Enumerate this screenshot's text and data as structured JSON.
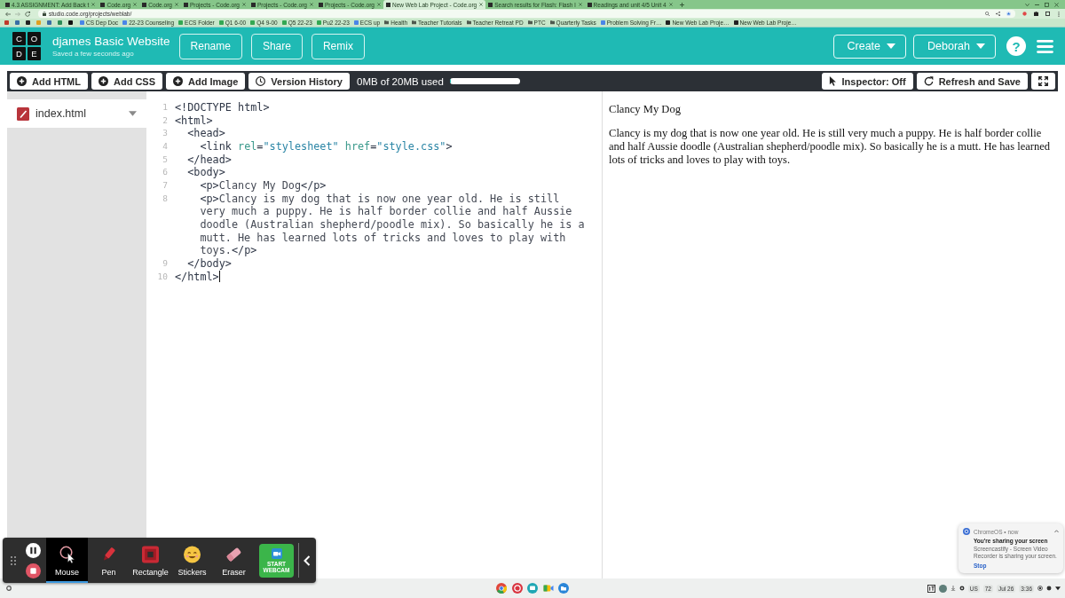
{
  "browser": {
    "tabs": [
      {
        "title": "4.3 ASSIGNMENT: Add Back t",
        "selected": false
      },
      {
        "title": "Code.org",
        "selected": false
      },
      {
        "title": "Code.org",
        "selected": false
      },
      {
        "title": "Projects - Code.org",
        "selected": false
      },
      {
        "title": "Projects - Code.org",
        "selected": false
      },
      {
        "title": "Projects - Code.org",
        "selected": false
      },
      {
        "title": "New Web Lab Project - Code.org",
        "selected": true
      },
      {
        "title": "Search results for Flash: Flash l",
        "selected": false
      },
      {
        "title": "Readings and unit 4/5 Unit 4",
        "selected": false
      }
    ],
    "url": "studio.code.org/projects/weblab/",
    "bookmarks": [
      {
        "kind": "doc",
        "label": "CS Dep Doc"
      },
      {
        "kind": "doc",
        "label": "22-23 Counseling"
      },
      {
        "kind": "sheet",
        "label": "ECS Folder"
      },
      {
        "kind": "sheet",
        "label": "Q1 6-00"
      },
      {
        "kind": "sheet",
        "label": "Q4 9-00"
      },
      {
        "kind": "sheet",
        "label": "Q5 22-23"
      },
      {
        "kind": "sheet",
        "label": "Pu2 22-23"
      },
      {
        "kind": "doc",
        "label": "ECS up"
      },
      {
        "kind": "folder",
        "label": "Health"
      },
      {
        "kind": "folder",
        "label": "Teacher Tutorials"
      },
      {
        "kind": "folder",
        "label": "Teacher Retreat PD"
      },
      {
        "kind": "folder",
        "label": "PTC"
      },
      {
        "kind": "folder",
        "label": "Quarterly Tasks"
      },
      {
        "kind": "doc",
        "label": "Problem Solving Fr…"
      },
      {
        "kind": "page",
        "label": "New Web Lab Proje…"
      },
      {
        "kind": "page",
        "label": "New Web Lab Proje…"
      }
    ]
  },
  "header": {
    "logo_letters": [
      "C",
      "O",
      "D",
      "E"
    ],
    "title": "djames Basic Website",
    "subtitle": "Saved a few seconds ago",
    "buttons": [
      "Rename",
      "Share",
      "Remix"
    ],
    "menus": [
      "Create",
      "Deborah"
    ],
    "help": "?"
  },
  "toolbar": {
    "buttons": [
      {
        "kind": "add",
        "label": "Add HTML"
      },
      {
        "kind": "add",
        "label": "Add CSS"
      },
      {
        "kind": "add",
        "label": "Add Image"
      },
      {
        "kind": "history",
        "label": "Version History"
      }
    ],
    "storage": {
      "label": "0MB of 20MB used",
      "level": 0
    },
    "right_buttons": [
      {
        "kind": "inspector",
        "label": "Inspector: Off"
      },
      {
        "kind": "refresh",
        "label": "Refresh and Save"
      },
      {
        "kind": "fullscreen"
      }
    ]
  },
  "files": [
    {
      "name": "index.html",
      "selected": true
    }
  ],
  "editor": {
    "lines": [
      {
        "number": "1",
        "caret": false,
        "segments": [
          {
            "kind": "tag",
            "text": "<!DOCTYPE html>"
          }
        ]
      },
      {
        "number": "2",
        "caret": false,
        "segments": [
          {
            "kind": "tag",
            "text": "<html>"
          }
        ]
      },
      {
        "number": "3",
        "caret": false,
        "segments": [
          {
            "kind": "tag",
            "text": "  <head>"
          }
        ]
      },
      {
        "number": "4",
        "caret": false,
        "segments": [
          {
            "kind": "tag",
            "text": "    <link "
          },
          {
            "kind": "attr",
            "text": "rel"
          },
          {
            "kind": "tag",
            "text": "="
          },
          {
            "kind": "string",
            "text": "\"stylesheet\""
          },
          {
            "kind": "attr",
            "text": " href"
          },
          {
            "kind": "tag",
            "text": "="
          },
          {
            "kind": "string",
            "text": "\"style.css\""
          },
          {
            "kind": "tag",
            "text": ">"
          }
        ]
      },
      {
        "number": "5",
        "caret": false,
        "segments": [
          {
            "kind": "tag",
            "text": "  </head>"
          }
        ]
      },
      {
        "number": "6",
        "caret": false,
        "segments": [
          {
            "kind": "tag",
            "text": "  <body>"
          }
        ]
      },
      {
        "number": "7",
        "caret": false,
        "segments": [
          {
            "kind": "tag",
            "text": "    <p>"
          },
          {
            "kind": "text",
            "text": "Clancy My Dog"
          },
          {
            "kind": "tag",
            "text": "</p>"
          }
        ]
      },
      {
        "number": "8",
        "caret": false,
        "segments": [
          {
            "kind": "tag",
            "text": "    <p>"
          },
          {
            "kind": "text",
            "text": "Clancy is my dog that is now one year old. He is still very much a puppy. He is half border collie and half Aussie doodle (Australian shepherd/poodle mix). So basically he is a mutt. He has learned lots of tricks and loves to play with toys."
          },
          {
            "kind": "tag",
            "text": "</p>"
          }
        ]
      },
      {
        "number": "9",
        "caret": false,
        "segments": [
          {
            "kind": "tag",
            "text": "  </body>"
          }
        ]
      },
      {
        "number": "10",
        "caret": true,
        "segments": [
          {
            "kind": "tag",
            "text": "</html>"
          }
        ]
      }
    ]
  },
  "preview": {
    "paragraphs": [
      "Clancy My Dog",
      "Clancy is my dog that is now one year old. He is still very much a puppy. He is half border collie and half Aussie doodle (Australian shepherd/poodle mix). So basically he is a mutt. He has learned lots of tricks and loves to play with toys."
    ]
  },
  "recorder": {
    "tools": [
      {
        "kind": "mouse",
        "label": "Mouse",
        "selected": true
      },
      {
        "kind": "pen",
        "label": "Pen",
        "selected": false
      },
      {
        "kind": "rectangle",
        "label": "Rectangle",
        "selected": false
      },
      {
        "kind": "stickers",
        "label": "Stickers",
        "selected": false
      },
      {
        "kind": "eraser",
        "label": "Eraser",
        "selected": false
      }
    ],
    "webcam_button": "START WEBCAM"
  },
  "notification": {
    "source": "ChromeOS • now",
    "title": "You're sharing your screen",
    "body": "Screencastify - Screen Video Recorder is sharing your screen.",
    "action": "Stop"
  },
  "shelf": {
    "tray": [
      "US",
      "72",
      "Jul 26",
      "3:36"
    ]
  }
}
